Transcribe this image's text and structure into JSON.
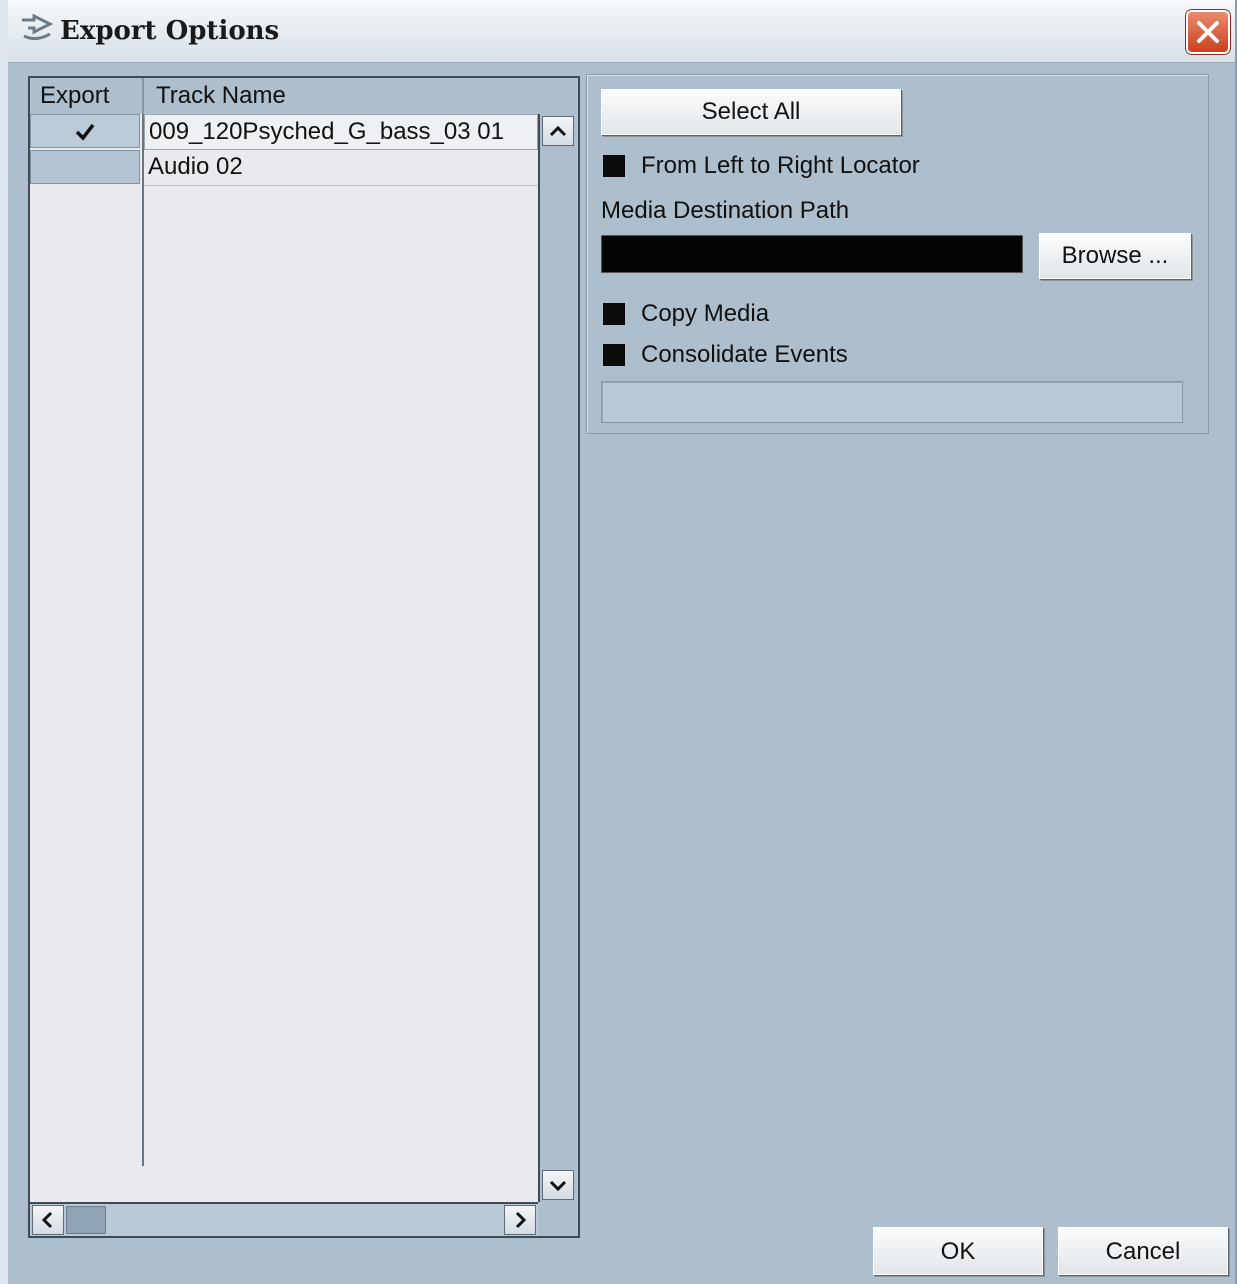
{
  "window": {
    "title": "Export Options"
  },
  "track_table": {
    "columns": [
      "Export",
      "Track Name"
    ],
    "rows": [
      {
        "export": true,
        "name": "009_120Psyched_G_bass_03 01"
      },
      {
        "export": false,
        "name": "Audio 02"
      }
    ]
  },
  "options": {
    "select_all_label": "Select All",
    "from_left_to_right_label": "From Left to Right Locator",
    "media_destination_label": "Media Destination Path",
    "media_destination_value": "",
    "browse_label": "Browse ...",
    "copy_media_label": "Copy Media",
    "consolidate_events_label": "Consolidate Events"
  },
  "footer": {
    "ok_label": "OK",
    "cancel_label": "Cancel"
  },
  "colors": {
    "window_bg": "#adbfcd",
    "table_bg": "#e9e9ee",
    "checkbox_fill": "#0b0b0b",
    "close_button": "#d9582f"
  }
}
